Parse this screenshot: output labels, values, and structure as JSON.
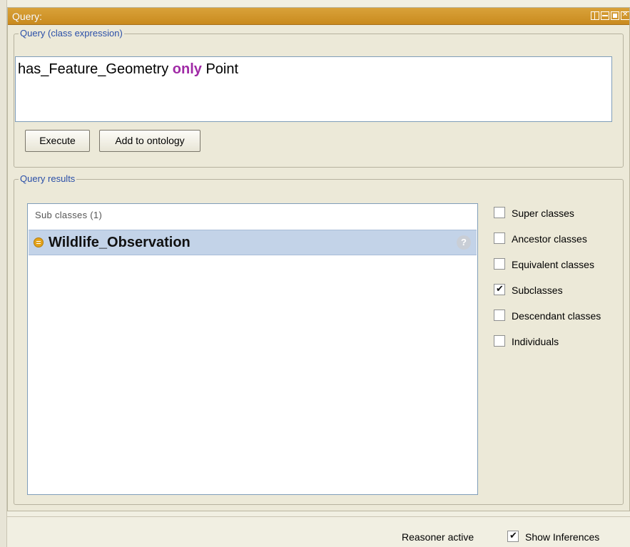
{
  "window": {
    "title": "Query:",
    "buttons": [
      "split-icon",
      "minimize-icon",
      "maximize-icon",
      "close-icon"
    ]
  },
  "query_group": {
    "legend": "Query (class expression)",
    "expression": {
      "before": "has_Feature_Geometry ",
      "keyword": "only",
      "after": " Point"
    },
    "execute_label": "Execute",
    "add_label": "Add to ontology"
  },
  "results_group": {
    "legend": "Query results",
    "list_header": "Sub classes (1)",
    "items": [
      {
        "label": "Wildlife_Observation",
        "icon": "class-icon",
        "help": "?"
      }
    ]
  },
  "options": [
    {
      "label": "Super classes",
      "checked": false
    },
    {
      "label": "Ancestor classes",
      "checked": false
    },
    {
      "label": "Equivalent classes",
      "checked": false
    },
    {
      "label": "Subclasses",
      "checked": true
    },
    {
      "label": "Descendant classes",
      "checked": false
    },
    {
      "label": "Individuals",
      "checked": false
    }
  ],
  "status": {
    "reasoner": "Reasoner active",
    "show_inferences": "Show Inferences",
    "show_inferences_checked": true
  },
  "colors": {
    "titlebar": "#c98a1e",
    "legend": "#2a4fa8",
    "keyword": "#a02aa6",
    "selection": "#c3d3e8",
    "class_icon": "#e3a21a"
  }
}
